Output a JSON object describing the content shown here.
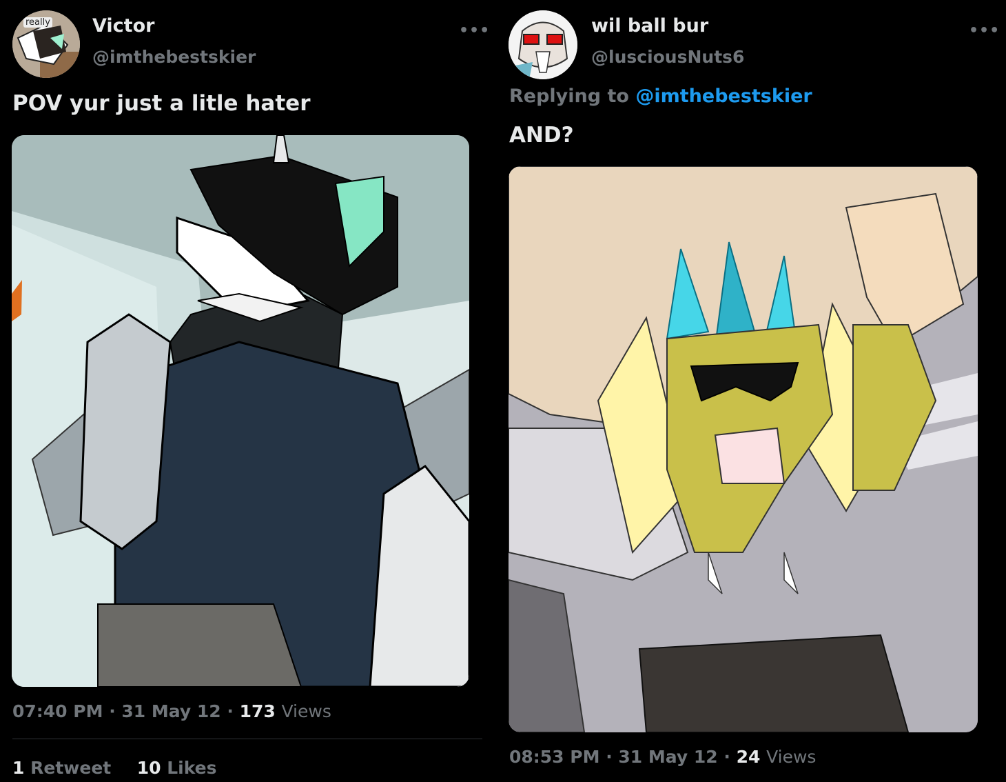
{
  "left_tweet": {
    "avatar_badge": "really",
    "display_name": "Victor",
    "handle": "@imthebestskier",
    "more_icon": "more-horizontal-icon",
    "text": "POV yur just a litle hater",
    "time": "07:40 PM",
    "date": "31 May 12",
    "views_count": "173",
    "views_label": "Views",
    "retweets_count": "1",
    "retweets_label": "Retweet",
    "likes_count": "10",
    "likes_label": "Likes"
  },
  "right_tweet": {
    "display_name": "wil ball bur",
    "handle": "@lusciousNuts6",
    "more_icon": "more-horizontal-icon",
    "replying_prefix": "Replying to",
    "replying_handle": "@imthebestskier",
    "text": "AND?",
    "time": "08:53 PM",
    "date": "31 May 12",
    "views_count": "24",
    "views_label": "Views"
  },
  "colors": {
    "background": "#000000",
    "primary_text": "#e7e9ea",
    "secondary_text": "#71767b",
    "link": "#1d9bf0",
    "divider": "#2f3336"
  }
}
